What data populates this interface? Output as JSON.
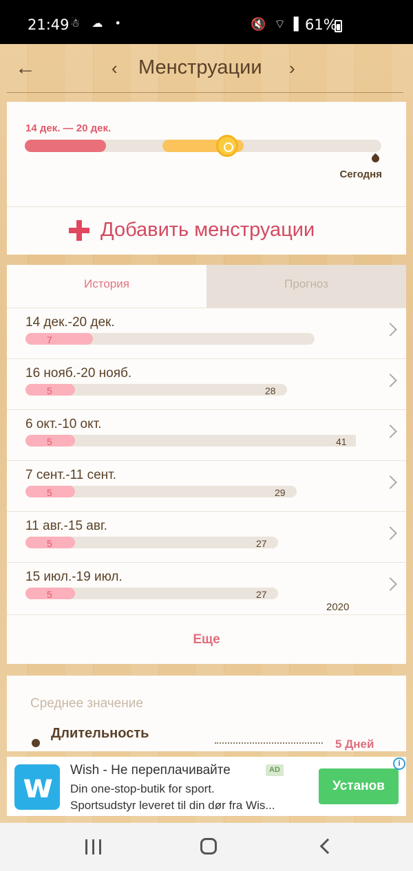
{
  "status": {
    "time": "21:49",
    "left_icons": "☃ ☁ •",
    "right_icons": "🔇 ⌔ ▌",
    "battery": "61%"
  },
  "header": {
    "title": "Менструации",
    "back_glyph": "←",
    "prev_glyph": "‹",
    "next_glyph": "›"
  },
  "current": {
    "range": "14 дек. — 20 дек.",
    "today_label": "Сегодня"
  },
  "add_button": {
    "label": "Добавить менструации"
  },
  "tabs": {
    "history": "История",
    "forecast": "Прогноз"
  },
  "history": [
    {
      "dates": "14 дек.-20 дек.",
      "period_days": "7",
      "cycle_days": ""
    },
    {
      "dates": "16 нояб.-20 нояб.",
      "period_days": "5",
      "cycle_days": "28"
    },
    {
      "dates": "6 окт.-10 окт.",
      "period_days": "5",
      "cycle_days": "41"
    },
    {
      "dates": "7 сент.-11 сент.",
      "period_days": "5",
      "cycle_days": "29"
    },
    {
      "dates": "11 авг.-15 авг.",
      "period_days": "5",
      "cycle_days": "27"
    },
    {
      "dates": "15 июл.-19 июл.",
      "period_days": "5",
      "cycle_days": "27"
    }
  ],
  "year_label": "2020",
  "more_label": "Еще",
  "average": {
    "heading": "Среднее значение",
    "duration_label": "Длительность",
    "duration_value": "5 Дней"
  },
  "ad": {
    "title": "Wish -  Не переплачивайте",
    "badge": "AD",
    "line1": "Din one-stop-butik for sport.",
    "line2": "Sportsudstyr leveret til din dør fra Wis...",
    "button": "Установ",
    "info": "i"
  },
  "colors": {
    "accent": "#e04860",
    "text_brown": "#5a4128",
    "period_pink": "#fbb0bb",
    "ovulation_yellow": "#fbc35a"
  }
}
